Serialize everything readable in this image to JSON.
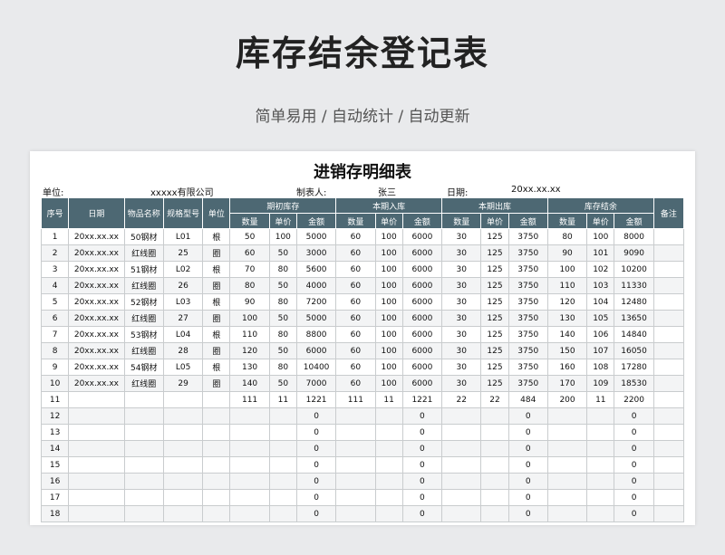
{
  "header": {
    "title": "库存结余登记表",
    "subtitle": "简单易用 / 自动统计 / 自动更新"
  },
  "sheet": {
    "title": "进销存明细表",
    "unit_label": "单位:",
    "unit_value": "xxxxx有限公司",
    "maker_label": "制表人:",
    "maker_value": "张三",
    "date_label": "日期:",
    "date_value": "20xx.xx.xx"
  },
  "table": {
    "headers": {
      "seq": "序号",
      "date": "日期",
      "name": "物品名称",
      "spec": "规格型号",
      "unit": "单位",
      "opening": "期初库存",
      "inbound": "本期入库",
      "outbound": "本期出库",
      "balance": "库存结余",
      "note": "备注",
      "qty": "数量",
      "price": "单价",
      "amount": "金额"
    },
    "rows": [
      [
        "1",
        "20xx.xx.xx",
        "50钢材",
        "L01",
        "根",
        "50",
        "100",
        "5000",
        "60",
        "100",
        "6000",
        "30",
        "125",
        "3750",
        "80",
        "100",
        "8000",
        ""
      ],
      [
        "2",
        "20xx.xx.xx",
        "红线圈",
        "25",
        "圈",
        "60",
        "50",
        "3000",
        "60",
        "100",
        "6000",
        "30",
        "125",
        "3750",
        "90",
        "101",
        "9090",
        ""
      ],
      [
        "3",
        "20xx.xx.xx",
        "51钢材",
        "L02",
        "根",
        "70",
        "80",
        "5600",
        "60",
        "100",
        "6000",
        "30",
        "125",
        "3750",
        "100",
        "102",
        "10200",
        ""
      ],
      [
        "4",
        "20xx.xx.xx",
        "红线圈",
        "26",
        "圈",
        "80",
        "50",
        "4000",
        "60",
        "100",
        "6000",
        "30",
        "125",
        "3750",
        "110",
        "103",
        "11330",
        ""
      ],
      [
        "5",
        "20xx.xx.xx",
        "52钢材",
        "L03",
        "根",
        "90",
        "80",
        "7200",
        "60",
        "100",
        "6000",
        "30",
        "125",
        "3750",
        "120",
        "104",
        "12480",
        ""
      ],
      [
        "6",
        "20xx.xx.xx",
        "红线圈",
        "27",
        "圈",
        "100",
        "50",
        "5000",
        "60",
        "100",
        "6000",
        "30",
        "125",
        "3750",
        "130",
        "105",
        "13650",
        ""
      ],
      [
        "7",
        "20xx.xx.xx",
        "53钢材",
        "L04",
        "根",
        "110",
        "80",
        "8800",
        "60",
        "100",
        "6000",
        "30",
        "125",
        "3750",
        "140",
        "106",
        "14840",
        ""
      ],
      [
        "8",
        "20xx.xx.xx",
        "红线圈",
        "28",
        "圈",
        "120",
        "50",
        "6000",
        "60",
        "100",
        "6000",
        "30",
        "125",
        "3750",
        "150",
        "107",
        "16050",
        ""
      ],
      [
        "9",
        "20xx.xx.xx",
        "54钢材",
        "L05",
        "根",
        "130",
        "80",
        "10400",
        "60",
        "100",
        "6000",
        "30",
        "125",
        "3750",
        "160",
        "108",
        "17280",
        ""
      ],
      [
        "10",
        "20xx.xx.xx",
        "红线圈",
        "29",
        "圈",
        "140",
        "50",
        "7000",
        "60",
        "100",
        "6000",
        "30",
        "125",
        "3750",
        "170",
        "109",
        "18530",
        ""
      ],
      [
        "11",
        "",
        "",
        "",
        "",
        "111",
        "11",
        "1221",
        "111",
        "11",
        "1221",
        "22",
        "22",
        "484",
        "200",
        "11",
        "2200",
        ""
      ],
      [
        "12",
        "",
        "",
        "",
        "",
        "",
        "",
        "0",
        "",
        "",
        "0",
        "",
        "",
        "0",
        "",
        "",
        "0",
        ""
      ],
      [
        "13",
        "",
        "",
        "",
        "",
        "",
        "",
        "0",
        "",
        "",
        "0",
        "",
        "",
        "0",
        "",
        "",
        "0",
        ""
      ],
      [
        "14",
        "",
        "",
        "",
        "",
        "",
        "",
        "0",
        "",
        "",
        "0",
        "",
        "",
        "0",
        "",
        "",
        "0",
        ""
      ],
      [
        "15",
        "",
        "",
        "",
        "",
        "",
        "",
        "0",
        "",
        "",
        "0",
        "",
        "",
        "0",
        "",
        "",
        "0",
        ""
      ],
      [
        "16",
        "",
        "",
        "",
        "",
        "",
        "",
        "0",
        "",
        "",
        "0",
        "",
        "",
        "0",
        "",
        "",
        "0",
        ""
      ],
      [
        "17",
        "",
        "",
        "",
        "",
        "",
        "",
        "0",
        "",
        "",
        "0",
        "",
        "",
        "0",
        "",
        "",
        "0",
        ""
      ],
      [
        "18",
        "",
        "",
        "",
        "",
        "",
        "",
        "0",
        "",
        "",
        "0",
        "",
        "",
        "0",
        "",
        "",
        "0",
        ""
      ]
    ]
  }
}
